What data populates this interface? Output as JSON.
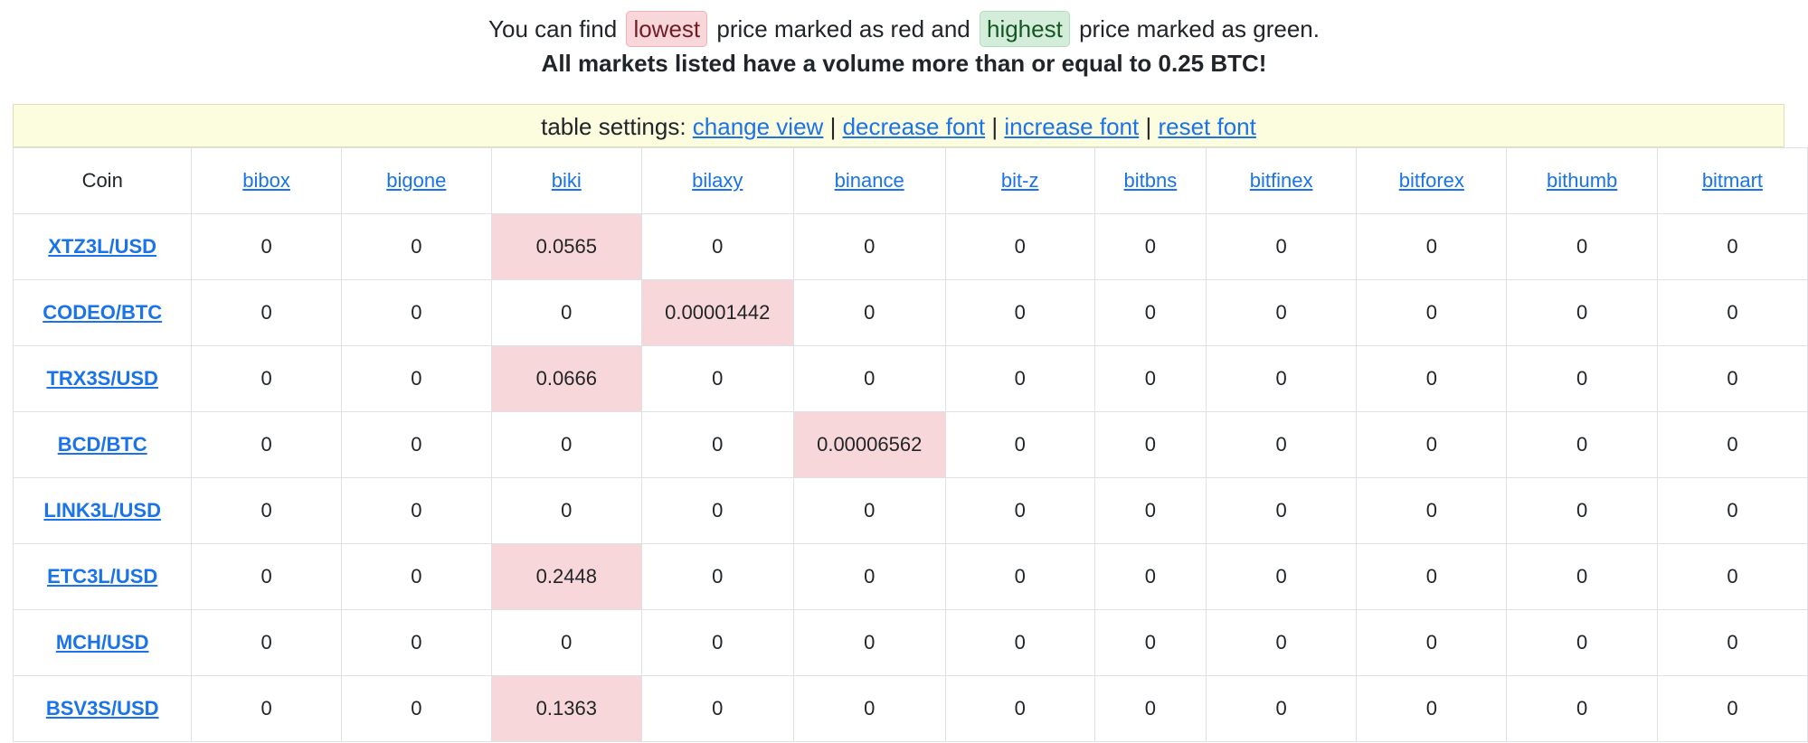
{
  "notice": {
    "prefix": "You can find",
    "lowest_label": "lowest",
    "middle": "price marked as red and",
    "highest_label": "highest",
    "suffix": "price marked as green.",
    "volume_note": "All markets listed have a volume more than or equal to 0.25 BTC!"
  },
  "settings": {
    "label": "table settings:",
    "separator": "|",
    "change_view": "change view",
    "decrease_font": "decrease font",
    "increase_font": "increase font",
    "reset_font": "reset font"
  },
  "colors": {
    "lowest": "#f8d7da",
    "highest": "#d4edda",
    "link": "#1a73e8",
    "settings_bg": "#fcfcdf"
  },
  "table": {
    "coin_header": "Coin",
    "exchanges": [
      "bibox",
      "bigone",
      "biki",
      "bilaxy",
      "binance",
      "bit-z",
      "bitbns",
      "bitfinex",
      "bitforex",
      "bithumb",
      "bitmart"
    ],
    "rows": [
      {
        "coin": "XTZ3L/USD",
        "values": [
          "0",
          "0",
          "0.0565",
          "0",
          "0",
          "0",
          "0",
          "0",
          "0",
          "0",
          "0"
        ],
        "low_index": 2
      },
      {
        "coin": "CODEO/BTC",
        "values": [
          "0",
          "0",
          "0",
          "0.00001442",
          "0",
          "0",
          "0",
          "0",
          "0",
          "0",
          "0"
        ],
        "low_index": 3
      },
      {
        "coin": "TRX3S/USD",
        "values": [
          "0",
          "0",
          "0.0666",
          "0",
          "0",
          "0",
          "0",
          "0",
          "0",
          "0",
          "0"
        ],
        "low_index": 2
      },
      {
        "coin": "BCD/BTC",
        "values": [
          "0",
          "0",
          "0",
          "0",
          "0.00006562",
          "0",
          "0",
          "0",
          "0",
          "0",
          "0"
        ],
        "low_index": 4
      },
      {
        "coin": "LINK3L/USD",
        "values": [
          "0",
          "0",
          "0",
          "0",
          "0",
          "0",
          "0",
          "0",
          "0",
          "0",
          "0"
        ],
        "low_index": -1
      },
      {
        "coin": "ETC3L/USD",
        "values": [
          "0",
          "0",
          "0.2448",
          "0",
          "0",
          "0",
          "0",
          "0",
          "0",
          "0",
          "0"
        ],
        "low_index": 2
      },
      {
        "coin": "MCH/USD",
        "values": [
          "0",
          "0",
          "0",
          "0",
          "0",
          "0",
          "0",
          "0",
          "0",
          "0",
          "0"
        ],
        "low_index": -1
      },
      {
        "coin": "BSV3S/USD",
        "values": [
          "0",
          "0",
          "0.1363",
          "0",
          "0",
          "0",
          "0",
          "0",
          "0",
          "0",
          "0"
        ],
        "low_index": 2
      }
    ]
  }
}
